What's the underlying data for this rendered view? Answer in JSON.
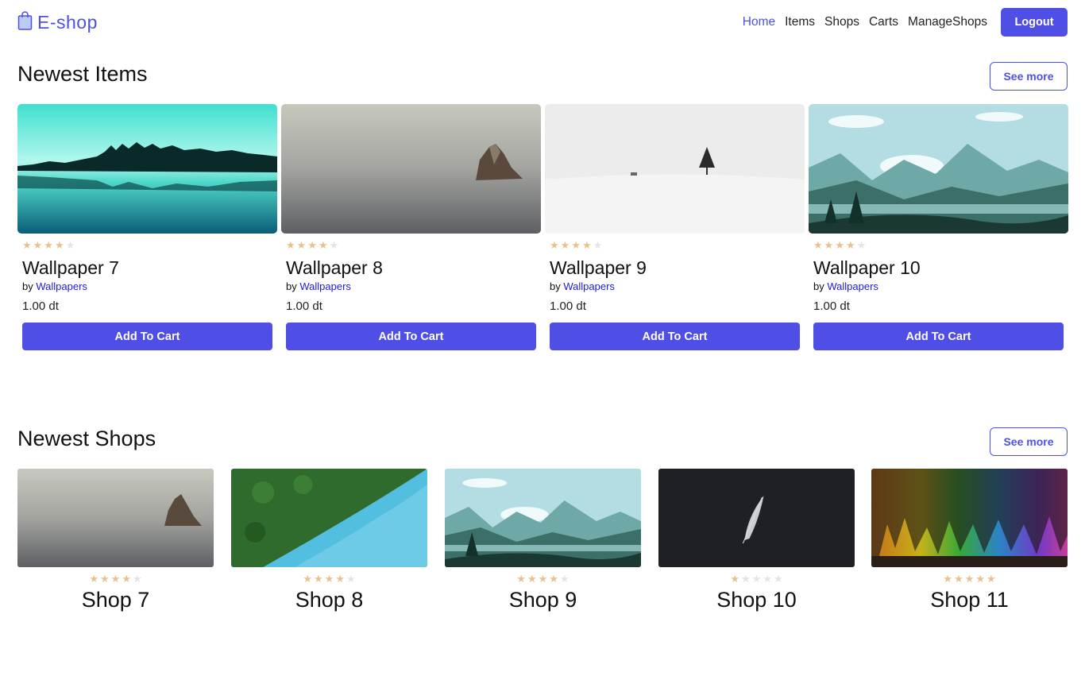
{
  "header": {
    "brand": "E-shop",
    "nav": [
      {
        "label": "Home",
        "active": true
      },
      {
        "label": "Items",
        "active": false
      },
      {
        "label": "Shops",
        "active": false
      },
      {
        "label": "Carts",
        "active": false
      },
      {
        "label": "ManageShops",
        "active": false
      }
    ],
    "logout_label": "Logout"
  },
  "items_section": {
    "title": "Newest Items",
    "see_more": "See more",
    "items": [
      {
        "title": "Wallpaper 7",
        "by": "by",
        "shop": "Wallpapers",
        "price": "1.00 dt",
        "rating": 4,
        "button": "Add To Cart",
        "image": "teal-lake-trees"
      },
      {
        "title": "Wallpaper 8",
        "by": "by",
        "shop": "Wallpapers",
        "price": "1.00 dt",
        "rating": 4,
        "button": "Add To Cart",
        "image": "grey-sea-rock"
      },
      {
        "title": "Wallpaper 9",
        "by": "by",
        "shop": "Wallpapers",
        "price": "1.00 dt",
        "rating": 4,
        "button": "Add To Cart",
        "image": "white-snow-tree"
      },
      {
        "title": "Wallpaper 10",
        "by": "by",
        "shop": "Wallpapers",
        "price": "1.00 dt",
        "rating": 4,
        "button": "Add To Cart",
        "image": "flat-mountains"
      }
    ]
  },
  "shops_section": {
    "title": "Newest Shops",
    "see_more": "See more",
    "shops": [
      {
        "title": "Shop 7",
        "rating": 4,
        "image": "grey-sea-rock"
      },
      {
        "title": "Shop 8",
        "rating": 4,
        "image": "forest-river-aerial"
      },
      {
        "title": "Shop 9",
        "rating": 4,
        "image": "flat-mountains"
      },
      {
        "title": "Shop 10",
        "rating": 1,
        "image": "dark-feather"
      },
      {
        "title": "Shop 11",
        "rating": 5,
        "image": "rainbow-crystals"
      }
    ]
  },
  "colors": {
    "accent": "#4f4fe6",
    "link": "#1c1cd6",
    "star_on": "#e8c192",
    "star_off": "#e4e4e4"
  }
}
